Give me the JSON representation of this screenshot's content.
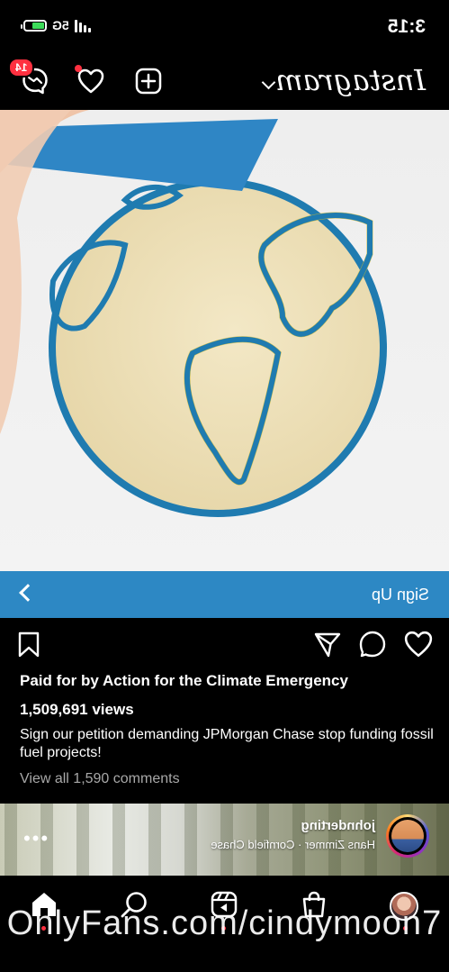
{
  "status": {
    "time": "3:15",
    "network": "5G"
  },
  "header": {
    "logo": "Instagram",
    "message_badge": "14"
  },
  "ad": {
    "cta_label": "Sign Up"
  },
  "post": {
    "sponsor": "Paid for by Action for the Climate Emergency",
    "views": "1,509,691 views",
    "description": "Sign our petition demanding JPMorgan Chase stop funding fossil fuel projects!",
    "comments_link": "View all 1,590 comments"
  },
  "music": {
    "user": "johnderting",
    "track": "Hans Zimmer · Cornfield Chase"
  },
  "watermark": "OnlyFans.com/cindymoon7",
  "colors": {
    "cta_bar": "#2d88c4",
    "badge": "#ff3040",
    "earth_outline": "#1f7bb0",
    "cookie": "#efe3be"
  },
  "icons": [
    "messenger-icon",
    "heart-icon",
    "new-post-icon",
    "like-icon",
    "comment-icon",
    "share-icon",
    "bookmark-icon",
    "home-icon",
    "search-icon",
    "reels-icon",
    "shop-icon",
    "profile-avatar",
    "chevron-right-icon",
    "chevron-down-icon",
    "more-icon"
  ]
}
